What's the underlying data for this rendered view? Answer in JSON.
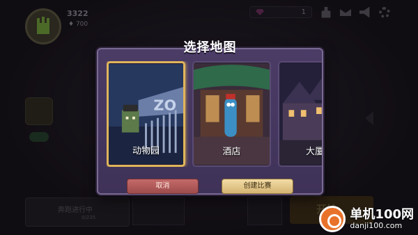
{
  "hud": {
    "player_level": "3322",
    "trophies": "700",
    "gems": "1",
    "icons": [
      "person-icon",
      "mail-icon",
      "announcement-icon",
      "settings-gear-icon"
    ]
  },
  "background": {
    "quest_title": "奔跑进行中",
    "quest_progress": "0/235",
    "quest_count": "1",
    "start_label": "开始"
  },
  "modal": {
    "title": "选择地图",
    "maps": [
      {
        "label": "动物园",
        "selected": true
      },
      {
        "label": "酒店",
        "selected": false
      },
      {
        "label": "大厦",
        "selected": false
      }
    ],
    "cancel_label": "取消",
    "create_label": "创建比赛"
  },
  "watermark": {
    "name": "单机100网",
    "url": "danji100.com"
  },
  "colors": {
    "modal_bg": "#4b3c66",
    "selected_border": "#e0b55a",
    "cancel": "#c46a6a",
    "create": "#f2dca5"
  }
}
